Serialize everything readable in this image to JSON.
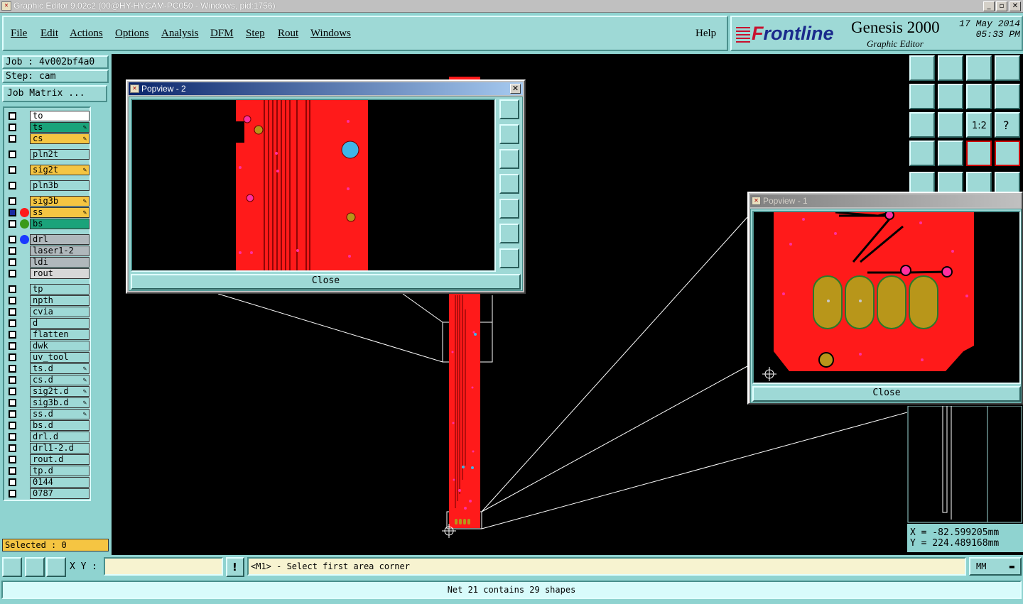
{
  "window": {
    "title": "Graphic Editor 9.02c2 (00@HY-HYCAM-PC050 - Windows, pid:1756)"
  },
  "menu": [
    "File",
    "Edit",
    "Actions",
    "Options",
    "Analysis",
    "DFM",
    "Step",
    "Rout",
    "Windows"
  ],
  "help": "Help",
  "brand": {
    "logo_prefix": "F",
    "logo_rest": "rontline",
    "product": "Genesis 2000",
    "subtitle": "Graphic Editor",
    "date": "17 May 2014",
    "time": "05:33 PM"
  },
  "job": {
    "job_label": "Job : 4v002bf4a0",
    "step_label": "Step: cam",
    "matrix_button": "Job Matrix ..."
  },
  "layers": [
    {
      "name": "to",
      "color": "#ffffff",
      "edit": false
    },
    {
      "name": "ts",
      "color": "#1aa37a",
      "edit": true
    },
    {
      "name": "cs",
      "color": "#f5c542",
      "edit": true
    },
    {
      "name": "pln2t",
      "color": "#9ed9d6",
      "edit": false
    },
    {
      "name": "sig2t",
      "color": "#f5c542",
      "edit": true
    },
    {
      "name": "pln3b",
      "color": "#9ed9d6",
      "edit": false
    },
    {
      "name": "sig3b",
      "color": "#f5c542",
      "edit": true
    },
    {
      "name": "ss",
      "color": "#f5c542",
      "edit": true
    },
    {
      "name": "bs",
      "color": "#1aa37a",
      "edit": false
    },
    {
      "name": "drl",
      "color": "#b0b8bc",
      "edit": false
    },
    {
      "name": "laser1-2",
      "color": "#b0b8bc",
      "edit": false
    },
    {
      "name": "ldi",
      "color": "#b0b8bc",
      "edit": false
    },
    {
      "name": "rout",
      "color": "#d8d8d8",
      "edit": false
    },
    {
      "name": "tp",
      "color": "#9ed9d6",
      "edit": false
    },
    {
      "name": "npth",
      "color": "#9ed9d6",
      "edit": false
    },
    {
      "name": "cvia",
      "color": "#9ed9d6",
      "edit": false
    },
    {
      "name": "d",
      "color": "#9ed9d6",
      "edit": false
    },
    {
      "name": "flatten",
      "color": "#9ed9d6",
      "edit": false
    },
    {
      "name": "dwk",
      "color": "#9ed9d6",
      "edit": false
    },
    {
      "name": "uv_tool",
      "color": "#9ed9d6",
      "edit": false
    },
    {
      "name": "ts.d",
      "color": "#9ed9d6",
      "edit": true
    },
    {
      "name": "cs.d",
      "color": "#9ed9d6",
      "edit": true
    },
    {
      "name": "sig2t.d",
      "color": "#9ed9d6",
      "edit": true
    },
    {
      "name": "sig3b.d",
      "color": "#9ed9d6",
      "edit": true
    },
    {
      "name": "ss.d",
      "color": "#9ed9d6",
      "edit": true
    },
    {
      "name": "bs.d",
      "color": "#9ed9d6",
      "edit": false
    },
    {
      "name": "drl.d",
      "color": "#9ed9d6",
      "edit": false
    },
    {
      "name": "drl1-2.d",
      "color": "#9ed9d6",
      "edit": false
    },
    {
      "name": "rout.d",
      "color": "#9ed9d6",
      "edit": false
    },
    {
      "name": "tp.d",
      "color": "#9ed9d6",
      "edit": false
    },
    {
      "name": "0144",
      "color": "#9ed9d6",
      "edit": false
    },
    {
      "name": "0787",
      "color": "#9ed9d6",
      "edit": false
    }
  ],
  "selected": "Selected : 0",
  "popview2": {
    "title": "Popview - 2",
    "close": "Close"
  },
  "popview1": {
    "title": "Popview - 1",
    "close": "Close"
  },
  "coords": {
    "x": "X = -82.599205mm",
    "y": "Y = 224.489168mm"
  },
  "bottom": {
    "xy_label": "X Y :",
    "xy_value": "",
    "prompt": "<M1> - Select first area corner",
    "units": "MM"
  },
  "status": "Net 21 contains 29 shapes",
  "colors": {
    "copper": "#ff1a1a",
    "pad": "#b8961a",
    "via": "#ff2fa0",
    "panel": "#9ed9d6"
  }
}
